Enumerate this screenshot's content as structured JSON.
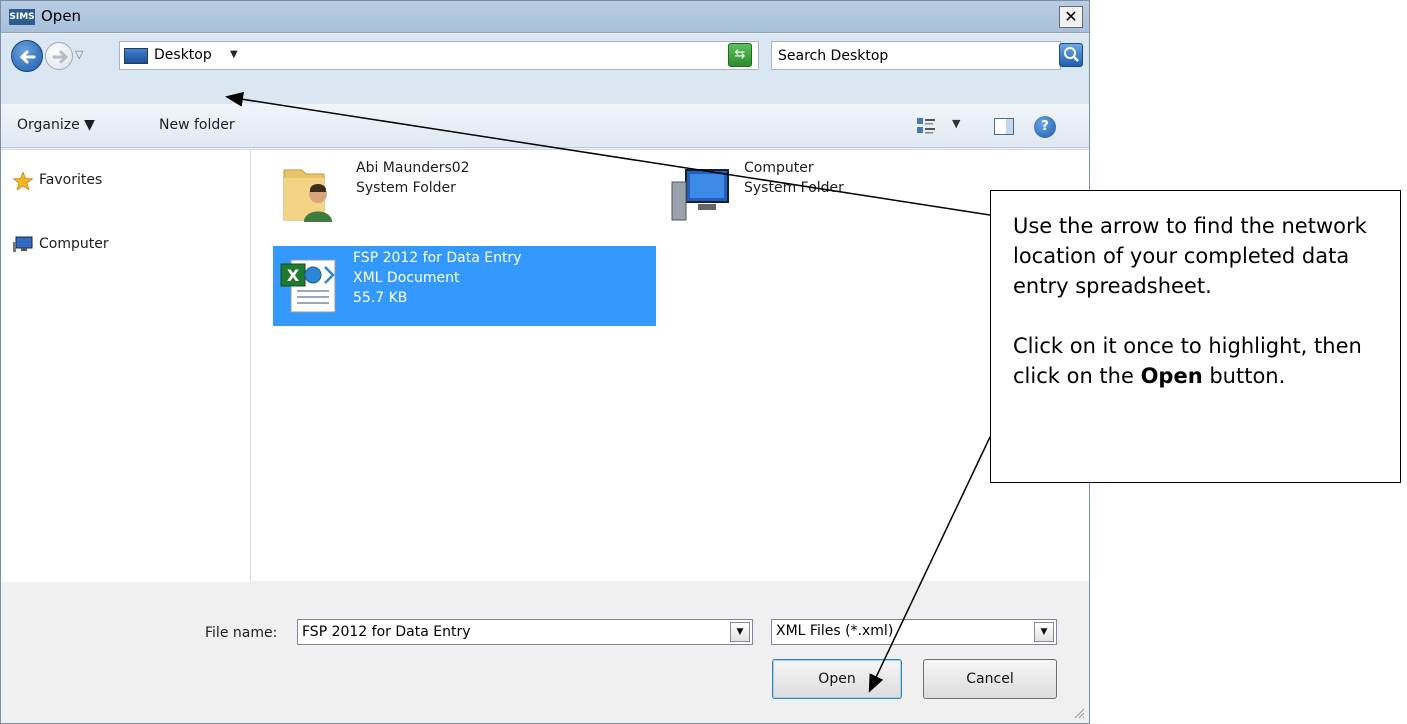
{
  "window": {
    "app_badge": "SIMS",
    "title": "Open",
    "close_glyph": "✕"
  },
  "address_bar": {
    "location": "Desktop",
    "chevron": "▼",
    "dropdown_arrow": "▼",
    "history_arrow": "▽"
  },
  "search": {
    "placeholder": "Search Desktop"
  },
  "toolbar": {
    "organize_label": "Organize ▼",
    "new_folder_label": "New folder",
    "view_dropdown": "▼",
    "help_glyph": "?"
  },
  "nav_pane": {
    "items": [
      {
        "label": "Favorites",
        "icon": "star-icon"
      },
      {
        "label": "Computer",
        "icon": "computer-icon"
      }
    ]
  },
  "files": [
    {
      "name": "Abi Maunders02",
      "type": "System Folder",
      "icon": "user-folder-icon",
      "selected": false
    },
    {
      "name": "Computer",
      "type": "System Folder",
      "icon": "computer-icon",
      "selected": false
    },
    {
      "name": "FSP 2012 for Data Entry",
      "type": "XML Document",
      "size": "55.7 KB",
      "icon": "excel-xml-icon",
      "selected": true
    }
  ],
  "footer": {
    "file_name_label": "File name:",
    "file_name_value": "FSP 2012 for Data Entry",
    "file_type_value": "XML Files (*.xml)",
    "combo_arrow": "▼",
    "open_label": "Open",
    "cancel_label": "Cancel"
  },
  "callout": {
    "para1": "Use the arrow to find the network location of your completed data entry spreadsheet.",
    "para2_prefix": "Click on it once to highlight, then click on the ",
    "para2_bold": "Open",
    "para2_suffix": " button."
  },
  "colors": {
    "selection": "#3399ff",
    "title_bar": "#b8cde4",
    "toolbar": "#dfe8f3"
  }
}
